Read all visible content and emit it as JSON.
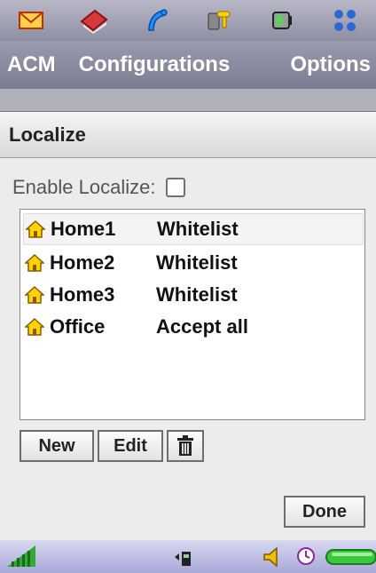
{
  "toolbar": {
    "icons": [
      "mail-icon",
      "book-icon",
      "phone-icon",
      "tools-icon",
      "device-icon",
      "apps-grid-icon"
    ]
  },
  "menu": {
    "acm": "ACM",
    "configurations": "Configurations",
    "options": "Options"
  },
  "page": {
    "title": "Localize"
  },
  "enable": {
    "label": "Enable Localize:"
  },
  "list": {
    "items": [
      {
        "name": "Home1",
        "policy": "Whitelist"
      },
      {
        "name": "Home2",
        "policy": "Whitelist"
      },
      {
        "name": "Home3",
        "policy": "Whitelist"
      },
      {
        "name": "Office",
        "policy": "Accept all"
      }
    ]
  },
  "buttons": {
    "new": "New",
    "edit": "Edit",
    "done": "Done"
  },
  "colors": {
    "menu_bg": "#8888a0",
    "status_bg": "#b8b8e0",
    "battery": "#3cc83c",
    "volume": "#f0c000"
  }
}
